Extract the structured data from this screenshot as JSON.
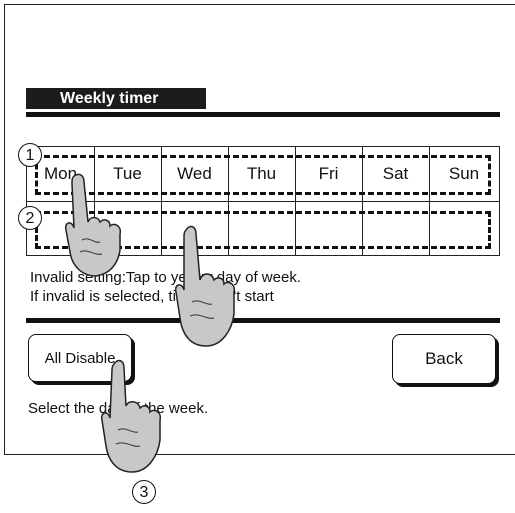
{
  "header": {
    "title": "Weekly timer"
  },
  "days": [
    "Mon",
    "Tue",
    "Wed",
    "Thu",
    "Fri",
    "Sat",
    "Sun"
  ],
  "notes": {
    "line1": "Invalid setting:Tap to yellow day of week.",
    "line2": "If invalid is selected, timer won't start"
  },
  "buttons": {
    "all_disable": "All Disable",
    "back": "Back"
  },
  "footer": {
    "instruction": "Select the day of the week."
  },
  "callouts": [
    "1",
    "2",
    "3"
  ]
}
